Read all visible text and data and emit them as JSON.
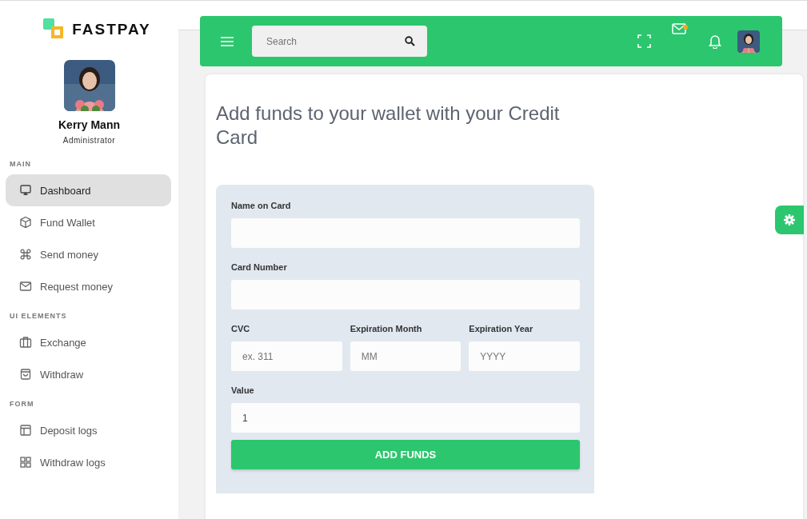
{
  "brand": {
    "name": "FASTPAY"
  },
  "profile": {
    "name": "Kerry Mann",
    "role": "Administrator"
  },
  "sidebar": {
    "sections": [
      {
        "title": "MAIN",
        "items": [
          {
            "label": "Dashboard",
            "selected": true
          },
          {
            "label": "Fund Wallet",
            "selected": false
          },
          {
            "label": "Send money",
            "selected": false
          },
          {
            "label": "Request money",
            "selected": false
          }
        ]
      },
      {
        "title": "UI ELEMENTS",
        "items": [
          {
            "label": "Exchange",
            "selected": false
          },
          {
            "label": "Withdraw",
            "selected": false
          }
        ]
      },
      {
        "title": "FORM",
        "items": [
          {
            "label": "Deposit logs",
            "selected": false
          },
          {
            "label": "Withdraw logs",
            "selected": false
          }
        ]
      }
    ]
  },
  "header": {
    "search": {
      "placeholder": "Search"
    },
    "mail_unread": true
  },
  "page": {
    "title": "Add funds to your wallet with your Credit Card"
  },
  "form": {
    "fields": [
      {
        "label": "Name on Card"
      },
      {
        "label": "Card Number"
      },
      {
        "label": "CVC",
        "placeholder": "ex. 311"
      },
      {
        "label": "Expiration Month",
        "placeholder": "MM"
      },
      {
        "label": "Expiration Year",
        "placeholder": "YYYY"
      },
      {
        "label": "Value",
        "value": "1"
      }
    ],
    "submit": "ADD FUNDS"
  }
}
